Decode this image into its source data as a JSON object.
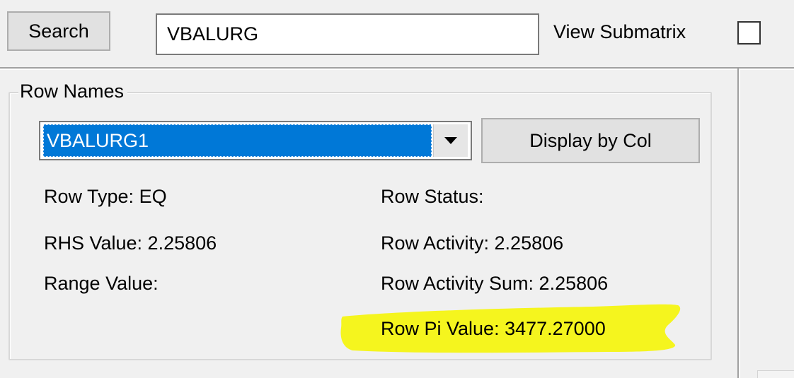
{
  "toolbar": {
    "search_label": "Search",
    "search_value": "VBALURG",
    "view_submatrix_label": "View Submatrix",
    "view_submatrix_checked": false
  },
  "row_names": {
    "group_label": "Row Names",
    "selected_row": "VBALURG1",
    "display_by_col_label": "Display by Col"
  },
  "row_info": {
    "row_type": "Row Type: EQ",
    "rhs_value": "RHS Value: 2.25806",
    "range_value": "Range Value:",
    "row_status": "Row Status:",
    "row_activity": "Row Activity: 2.25806",
    "row_activity_sum": "Row Activity Sum: 2.25806",
    "row_pi_value": "Row Pi Value: 3477.27000"
  },
  "colors": {
    "selection": "#0078d7",
    "highlight": "#f5f51e",
    "window_bg": "#f0f0f0"
  },
  "icons": {
    "dropdown_arrow": "chevron-down-icon",
    "highlight_mark": "highlighter-mark"
  }
}
